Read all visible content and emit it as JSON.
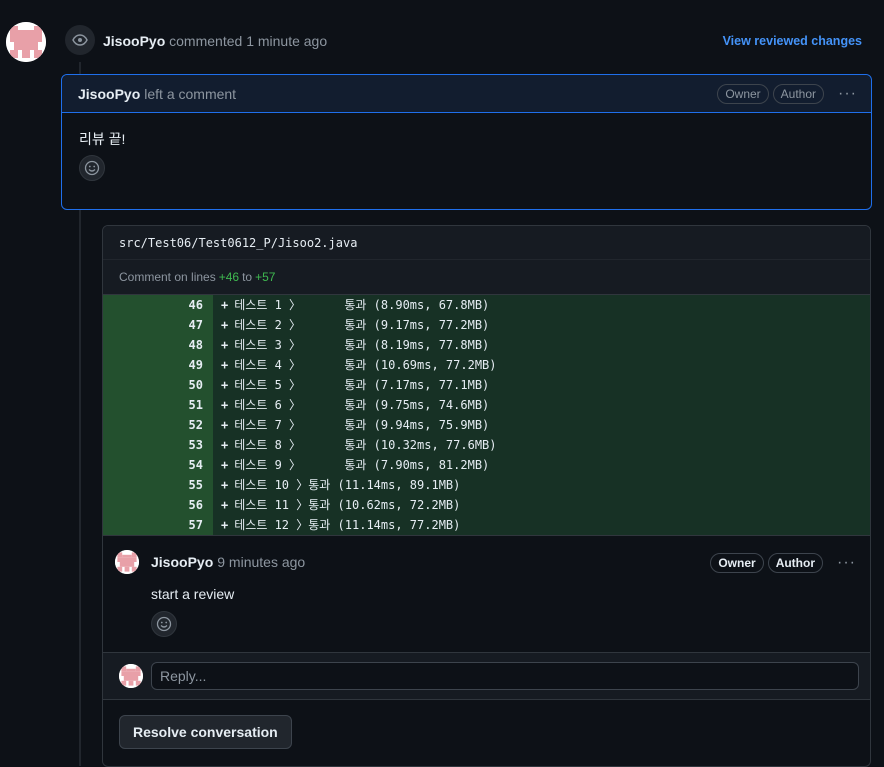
{
  "event": {
    "author": "JisooPyo",
    "action": "commented",
    "time": "1 minute ago",
    "view_changes": "View reviewed changes"
  },
  "comment": {
    "author": "JisooPyo",
    "action": "left a comment",
    "badges": [
      "Owner",
      "Author"
    ],
    "body": "리뷰 끝!"
  },
  "review": {
    "file_path": "src/Test06/Test0612_P/Jisoo2.java",
    "lines_prefix": "Comment on lines",
    "line_start": "+46",
    "lines_to": "to",
    "line_end": "+57",
    "diff_lines": [
      {
        "num": "46",
        "text": "테스트 1 〉      통과 (8.90ms, 67.8MB)"
      },
      {
        "num": "47",
        "text": "테스트 2 〉      통과 (9.17ms, 77.2MB)"
      },
      {
        "num": "48",
        "text": "테스트 3 〉      통과 (8.19ms, 77.8MB)"
      },
      {
        "num": "49",
        "text": "테스트 4 〉      통과 (10.69ms, 77.2MB)"
      },
      {
        "num": "50",
        "text": "테스트 5 〉      통과 (7.17ms, 77.1MB)"
      },
      {
        "num": "51",
        "text": "테스트 6 〉      통과 (9.75ms, 74.6MB)"
      },
      {
        "num": "52",
        "text": "테스트 7 〉      통과 (9.94ms, 75.9MB)"
      },
      {
        "num": "53",
        "text": "테스트 8 〉      통과 (10.32ms, 77.6MB)"
      },
      {
        "num": "54",
        "text": "테스트 9 〉      통과 (7.90ms, 81.2MB)"
      },
      {
        "num": "55",
        "text": "테스트 10 〉통과 (11.14ms, 89.1MB)"
      },
      {
        "num": "56",
        "text": "테스트 11 〉통과 (10.62ms, 72.2MB)"
      },
      {
        "num": "57",
        "text": "테스트 12 〉통과 (11.14ms, 77.2MB)"
      }
    ],
    "reply": {
      "author": "JisooPyo",
      "time": "9 minutes ago",
      "badges": [
        "Owner",
        "Author"
      ],
      "body": "start a review"
    },
    "reply_placeholder": "Reply...",
    "resolve_label": "Resolve conversation"
  },
  "colors": {
    "accent": "#1f6feb",
    "link": "#4493f8",
    "added_num_bg": "#23502e",
    "added_code_bg": "#173125",
    "added_text": "#3fb950",
    "avatar_pink": "#e8a0a8"
  },
  "icons": [
    "eye-icon",
    "smiley-icon",
    "kebab-menu-icon",
    "identicon-avatar"
  ]
}
